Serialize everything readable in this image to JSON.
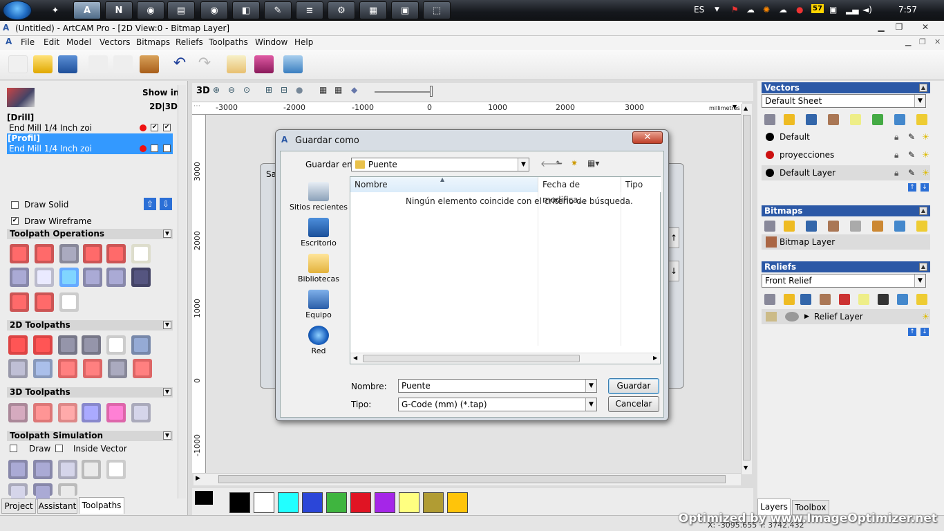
{
  "taskbar": {
    "language": "ES",
    "clock": "7:57",
    "badge": "57",
    "apps": [
      "artcam-app",
      "norton-app",
      "chrome-app",
      "explorer-app",
      "chrome2-app",
      "app-6",
      "notepad-app",
      "books-app",
      "app-9",
      "app-10",
      "app-11",
      "app-12"
    ]
  },
  "window": {
    "title": "(Untitled) - ArtCAM Pro - [2D View:0 - Bitmap Layer]"
  },
  "menu": [
    "File",
    "Edit",
    "Model",
    "Vectors",
    "Bitmaps",
    "Reliefs",
    "Toolpaths",
    "Window",
    "Help"
  ],
  "leftpanel": {
    "show_in": "Show in",
    "show_in_modes": "2D|3D",
    "drill_group": "[Drill]",
    "drill_tool": "End Mill 1/4 Inch zoi",
    "profil_group": "[Profil]",
    "profil_tool": "End Mill 1/4 Inch zoi",
    "draw_solid": "Draw Solid",
    "draw_wireframe": "Draw Wireframe",
    "sections": {
      "toolpath_ops": "Toolpath Operations",
      "toolpaths_2d": "2D Toolpaths",
      "toolpaths_3d": "3D Toolpaths",
      "simulation": "Toolpath Simulation"
    },
    "sim_draw": "Draw",
    "sim_inside_vector": "Inside Vector",
    "tabs": [
      "Project",
      "Assistant",
      "Toolpaths"
    ]
  },
  "canvas": {
    "view_label": "3D",
    "units": "millimetres",
    "hruler": [
      "-3000",
      "-2000",
      "-1000",
      "0",
      "1000",
      "2000",
      "3000"
    ],
    "vruler": [
      "3000",
      "2000",
      "1000",
      "0",
      "-1000"
    ]
  },
  "palette": {
    "colors": [
      "#000000",
      "#ffffff",
      "#22ffff",
      "#2b46d8",
      "#3fb53f",
      "#e01423",
      "#a526e8",
      "#ffff80",
      "#b19c33",
      "#ffc40a"
    ]
  },
  "vectors": {
    "title": "Vectors",
    "sheet": "Default Sheet",
    "layers": [
      {
        "name": "Default",
        "color": "#000000"
      },
      {
        "name": "proyecciones",
        "color": "#cc1111"
      },
      {
        "name": "Default Layer",
        "color": "#000000"
      }
    ]
  },
  "bitmaps": {
    "title": "Bitmaps",
    "layer": "Bitmap Layer"
  },
  "reliefs": {
    "title": "Reliefs",
    "relief": "Front Relief",
    "layer": "Relief Layer"
  },
  "righttabs": [
    "Layers",
    "Toolbox"
  ],
  "status": {
    "coords": "X: -3095.655 Y: 3742.432"
  },
  "dialog": {
    "title": "Guardar como",
    "save_in_label": "Guardar en:",
    "save_in_value": "Puente",
    "nav": [
      "Sitios recientes",
      "Escritorio",
      "Bibliotecas",
      "Equipo",
      "Red"
    ],
    "columns": [
      "Nombre",
      "Fecha de modifica...",
      "Tipo"
    ],
    "empty_message": "Ningún elemento coincide con el criterio de búsqueda.",
    "name_label": "Nombre:",
    "name_value": "Puente",
    "type_label": "Tipo:",
    "type_value": "G-Code (mm) (*.tap)",
    "save_button": "Guardar",
    "cancel_button": "Cancelar",
    "behind_dialog_label": "Sa"
  },
  "watermark": "Optimized by www.ImageOptimizer.net"
}
